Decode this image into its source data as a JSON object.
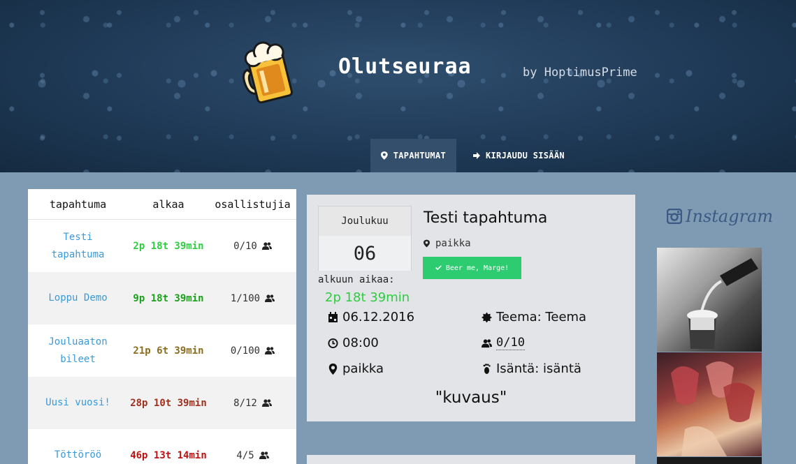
{
  "site": {
    "title": "Olutseuraa",
    "by": "by HoptimusPrime"
  },
  "nav": {
    "events_label": "TAPAHTUMAT",
    "login_label": "KIRJAUDU SISÄÄN"
  },
  "events_table": {
    "headers": [
      "tapahtuma",
      "alkaa",
      "osallistujia"
    ],
    "rows": [
      {
        "name": "Testi tapahtuma",
        "starts": "2p 18t 39min",
        "participants": "0/10",
        "color": "#2ecc40"
      },
      {
        "name": "Loppu Demo",
        "starts": "9p 18t 39min",
        "participants": "1/100",
        "color": "#1aa01a"
      },
      {
        "name": "Jouluaaton bileet",
        "starts": "21p 6t 39min",
        "participants": "0/100",
        "color": "#8a6d1e"
      },
      {
        "name": "Uusi vuosi!",
        "starts": "28p 10t 39min",
        "participants": "8/12",
        "color": "#a0301e"
      },
      {
        "name": "Töttöröö",
        "starts": "46p 13t 14min",
        "participants": "4/5",
        "color": "#c01010"
      }
    ]
  },
  "event": {
    "month": "Joulukuu",
    "day": "06",
    "until_label": "alkuun aikaa:",
    "until_value": "2p 18t 39min",
    "title": "Testi tapahtuma",
    "place_short": "paikka",
    "beer_button": "Beer me, Marge!",
    "date": "06.12.2016",
    "time": "08:00",
    "place": "paikka",
    "theme": "Teema: Teema",
    "participants": "0/10",
    "host": "Isäntä: isäntä",
    "description": "\"kuvaus\""
  },
  "instagram": {
    "label": "Instagram"
  },
  "colors": {
    "accent_green": "#2ecc71",
    "link_blue": "#3a9ad9",
    "background": "#7f9bb3"
  }
}
